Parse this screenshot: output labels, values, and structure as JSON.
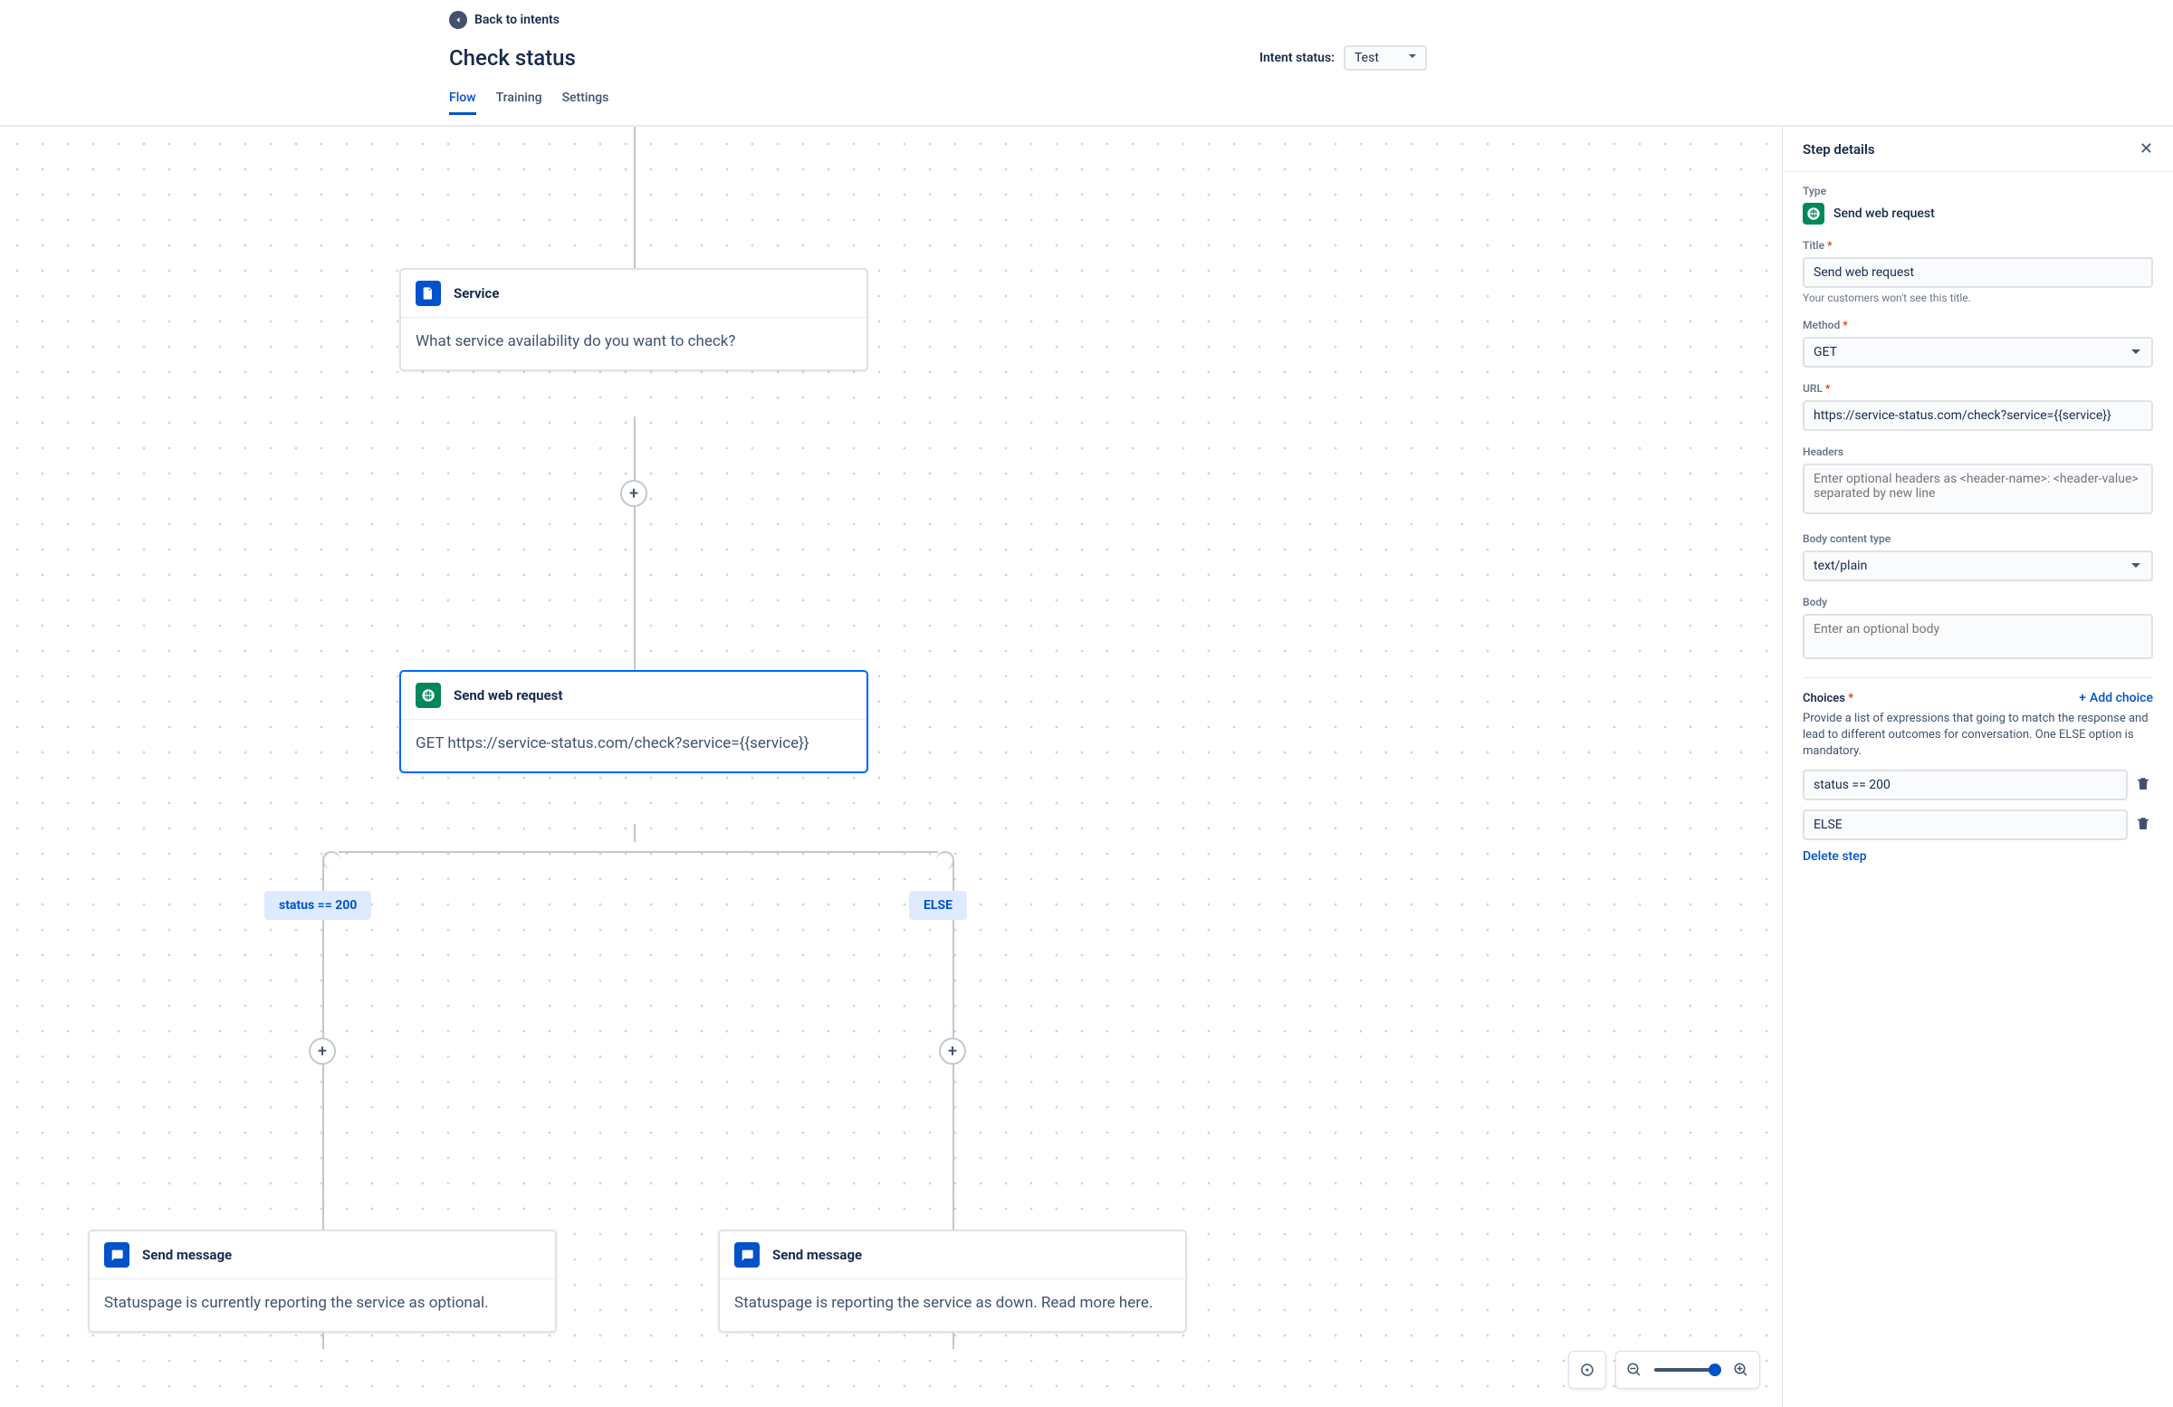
{
  "header": {
    "back_label": "Back to intents",
    "title": "Check status",
    "intent_status_label": "Intent status:",
    "intent_status_value": "Test",
    "tabs": {
      "flow": "Flow",
      "training": "Training",
      "settings": "Settings"
    }
  },
  "nodes": {
    "service": {
      "title": "Service",
      "body": "What service availability do you want to check?"
    },
    "webrequest": {
      "title": "Send web request",
      "body": "GET https://service-status.com/check?service={{service}}"
    },
    "branch_left": "status == 200",
    "branch_right": "ELSE",
    "msg_left": {
      "title": "Send message",
      "body": "Statuspage is currently reporting the service as optional."
    },
    "msg_right": {
      "title": "Send message",
      "body": "Statuspage is reporting the service as down. Read more here."
    }
  },
  "panel": {
    "header": "Step details",
    "type_label": "Type",
    "type_value": "Send web request",
    "title_label": "Title",
    "title_value": "Send web request",
    "title_hint": "Your customers won't see this title.",
    "method_label": "Method",
    "method_value": "GET",
    "url_label": "URL",
    "url_value": "https://service-status.com/check?service={{service}}",
    "headers_label": "Headers",
    "headers_placeholder": "Enter optional headers as <header-name>: <header-value> separated by new line",
    "body_type_label": "Body content type",
    "body_type_value": "text/plain",
    "body_label": "Body",
    "body_placeholder": "Enter an optional body",
    "choices_label": "Choices",
    "add_choice_label": "Add choice",
    "choices_desc": "Provide a list of expressions that going to match the response and lead to different outcomes for conversation. One ELSE option is mandatory.",
    "choice_1": "status == 200",
    "choice_2": "ELSE",
    "delete_step": "Delete step"
  }
}
